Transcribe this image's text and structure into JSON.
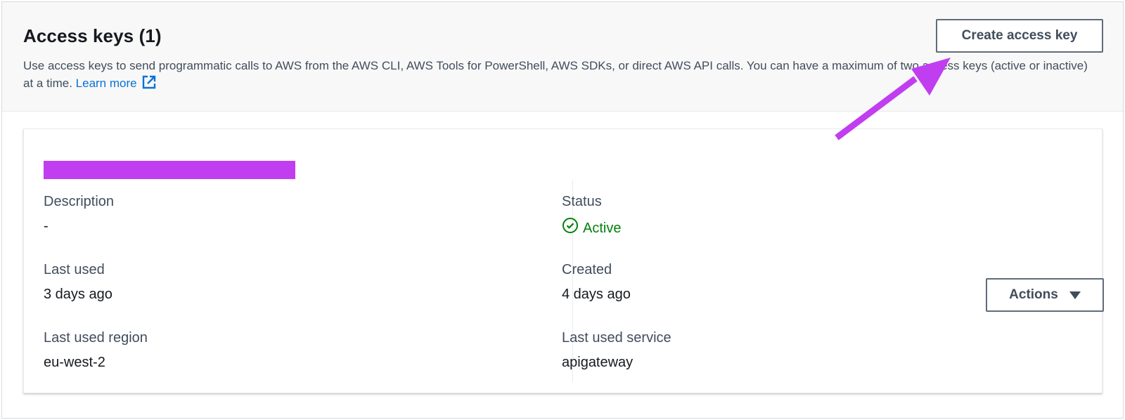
{
  "header": {
    "title": "Access keys (1)",
    "description": "Use access keys to send programmatic calls to AWS from the AWS CLI, AWS Tools for PowerShell, AWS SDKs, or direct AWS API calls. You can have a maximum of two access keys (active or inactive) at a time.",
    "learn_more": "Learn more",
    "create_button": "Create access key"
  },
  "key_card": {
    "actions_button": "Actions",
    "left": [
      {
        "label": "Description",
        "value": "-"
      },
      {
        "label": "Last used",
        "value": "3 days ago"
      },
      {
        "label": "Last used region",
        "value": "eu-west-2"
      }
    ],
    "right": [
      {
        "label": "Status",
        "value": "Active",
        "icon": "check-circle-icon"
      },
      {
        "label": "Created",
        "value": "4 days ago"
      },
      {
        "label": "Last used service",
        "value": "apigateway"
      }
    ]
  },
  "colors": {
    "link": "#0972d3",
    "status_active": "#037f0c",
    "annotation": "#c13ef0"
  }
}
